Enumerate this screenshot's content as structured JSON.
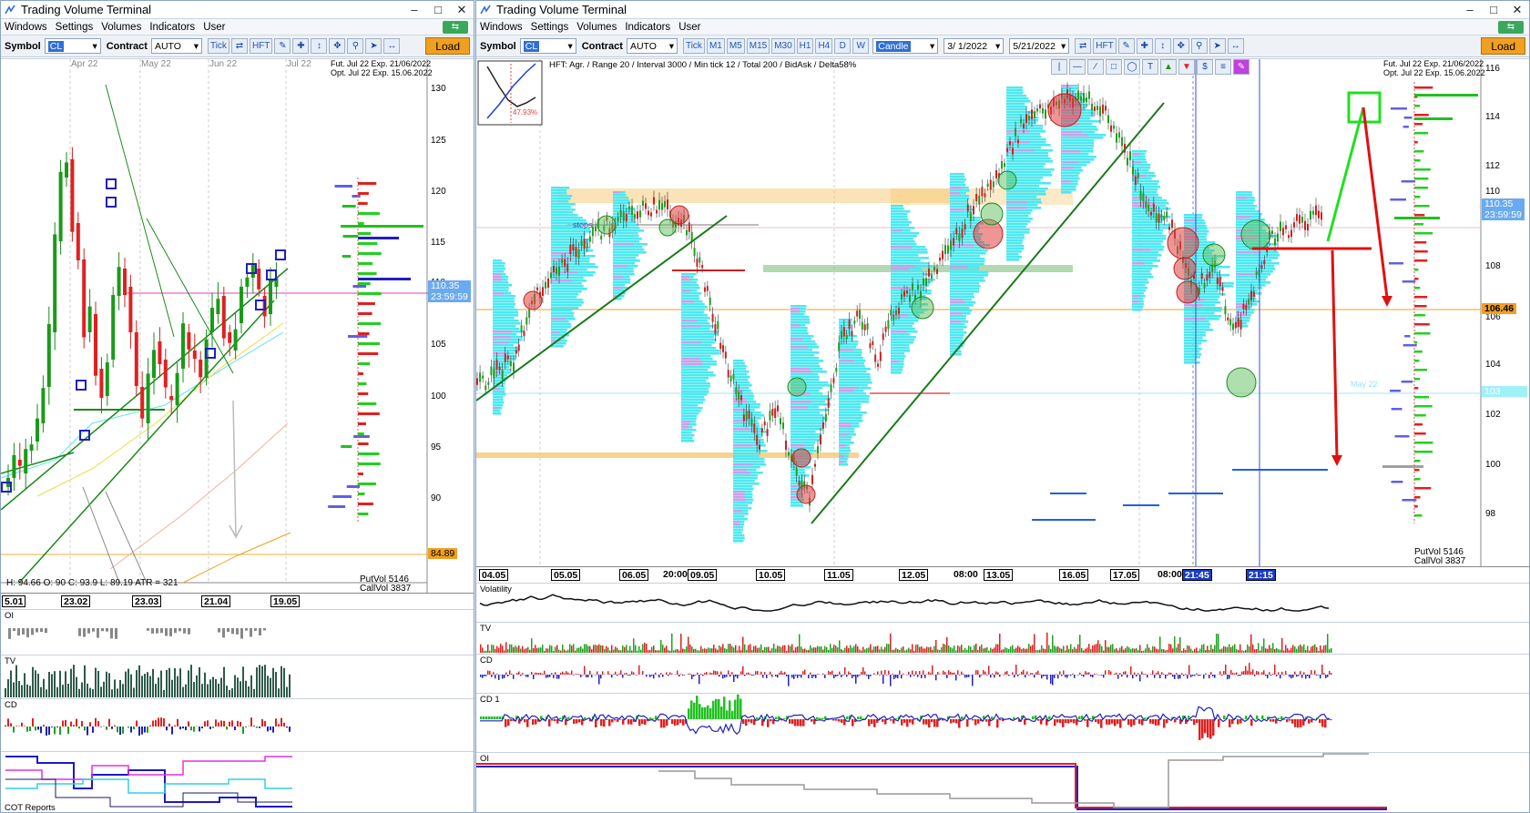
{
  "left_window": {
    "title": "Trading Volume Terminal",
    "menu": [
      "Windows",
      "Settings",
      "Volumes",
      "Indicators",
      "User"
    ],
    "toolbar": {
      "symbol_label": "Symbol",
      "symbol_value": "CL",
      "contract_label": "Contract",
      "contract_value": "AUTO",
      "buttons": [
        "Tick",
        "HFT"
      ],
      "load_label": "Load"
    },
    "chart": {
      "expiry_fut": "Fut. Jul 22 Exp. 21/06/2022",
      "expiry_opt": "Opt. Jul 22 Exp. 15.06.2022",
      "month_labels": [
        "Apr 22",
        "May 22",
        "Jun 22",
        "Jul 22"
      ],
      "price_ticks": [
        "130",
        "125",
        "120",
        "115",
        "110",
        "105",
        "100",
        "95",
        "90"
      ],
      "current_price": "110.35",
      "current_time": "23:59:59",
      "level_price": "84.89",
      "ohlc": "H: 94.66  O: 90  C: 93.9  L: 89.19  ATR = 321",
      "putvol": "PutVol  5146",
      "callvol": "CallVol  3837",
      "dates": [
        "5.01",
        "23.02",
        "23.03",
        "21.04",
        "19.05"
      ]
    },
    "panels": [
      "OI",
      "TV",
      "CD",
      "COT Reports"
    ]
  },
  "right_window": {
    "title": "Trading Volume Terminal",
    "menu": [
      "Windows",
      "Settings",
      "Volumes",
      "Indicators",
      "User"
    ],
    "toolbar": {
      "symbol_label": "Symbol",
      "symbol_value": "CL",
      "contract_label": "Contract",
      "contract_value": "AUTO",
      "timeframes": [
        "Tick",
        "M1",
        "M5",
        "M15",
        "M30",
        "H1",
        "H4",
        "D",
        "W"
      ],
      "chart_type": "Candle",
      "date_from": "3/ 1/2022",
      "date_to": "5/21/2022",
      "hft_label": "HFT",
      "load_label": "Load"
    },
    "chart": {
      "info": "HFT: Agr. / Range 20 / Interval 3000 / Min tick 12 / Total 200 / BidAsk / Delta58%",
      "inset_pct": "47.93%",
      "expiry_fut": "Fut. Jul 22 Exp. 21/06/2022",
      "expiry_opt": "Opt. Jul 22 Exp. 15.06.2022",
      "price_ticks": [
        "116",
        "114",
        "112",
        "110",
        "108",
        "106",
        "104",
        "102",
        "100",
        "98"
      ],
      "current_price": "110.35",
      "current_time": "23:59:59",
      "level_price": "106.46",
      "low_level": "103",
      "may_label": "May 22",
      "stops_label": "stops",
      "putvol": "PutVol  5146",
      "callvol": "CallVol  3837",
      "dates": [
        "04.05",
        "05.05",
        "06.05",
        "20:00",
        "09.05",
        "10.05",
        "11.05",
        "12.05",
        "08:00",
        "13.05",
        "16.05",
        "17.05",
        "08:00",
        "21:45",
        "21:15"
      ]
    },
    "panels": [
      "Volatility",
      "TV",
      "CD",
      "CD 1",
      "OI"
    ]
  },
  "colors": {
    "accent_blue": "#2f6fd6",
    "load_orange": "#f0a020",
    "bull_green": "#1a9a1a",
    "bear_red": "#e02020",
    "profile_cyan": "#4de8f0",
    "profile_violet": "#c8a0e8",
    "level_orange": "#f5c060"
  }
}
